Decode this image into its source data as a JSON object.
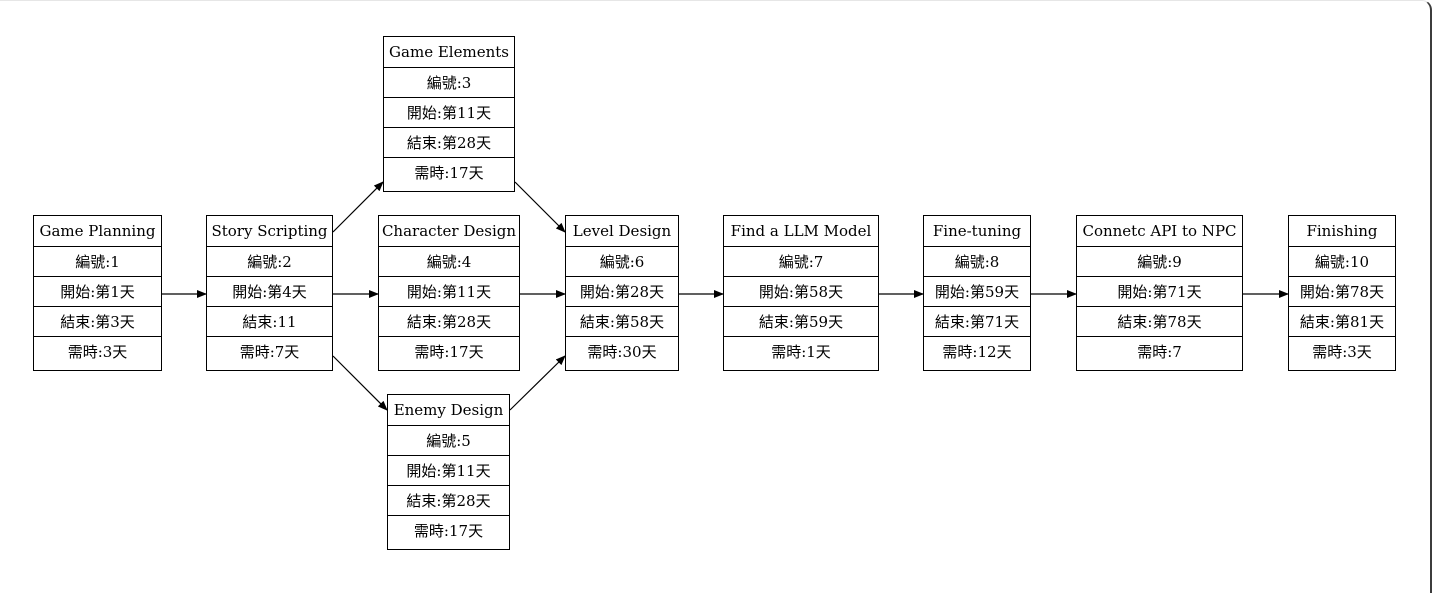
{
  "diagram": {
    "nodes": [
      {
        "id": "n1",
        "title": "Game Planning",
        "fields": [
          "編號:1",
          "開始:第1天",
          "結束:第3天",
          "需時:3天"
        ]
      },
      {
        "id": "n2",
        "title": "Story Scripting",
        "fields": [
          "編號:2",
          "開始:第4天",
          "結束:11",
          "需時:7天"
        ]
      },
      {
        "id": "n3",
        "title": "Game Elements",
        "fields": [
          "編號:3",
          "開始:第11天",
          "結束:第28天",
          "需時:17天"
        ]
      },
      {
        "id": "n4",
        "title": "Character Design",
        "fields": [
          "編號:4",
          "開始:第11天",
          "結束:第28天",
          "需時:17天"
        ]
      },
      {
        "id": "n5",
        "title": "Enemy Design",
        "fields": [
          "編號:5",
          "開始:第11天",
          "結束:第28天",
          "需時:17天"
        ]
      },
      {
        "id": "n6",
        "title": "Level Design",
        "fields": [
          "編號:6",
          "開始:第28天",
          "結束:第58天",
          "需時:30天"
        ]
      },
      {
        "id": "n7",
        "title": "Find a LLM Model",
        "fields": [
          "編號:7",
          "開始:第58天",
          "結束:第59天",
          "需時:1天"
        ]
      },
      {
        "id": "n8",
        "title": "Fine-tuning",
        "fields": [
          "編號:8",
          "開始:第59天",
          "結束:第71天",
          "需時:12天"
        ]
      },
      {
        "id": "n9",
        "title": "Connetc API to NPC",
        "fields": [
          "編號:9",
          "開始:第71天",
          "結束:第78天",
          "需時:7"
        ]
      },
      {
        "id": "n10",
        "title": "Finishing",
        "fields": [
          "編號:10",
          "開始:第78天",
          "結束:第81天",
          "需時:3天"
        ]
      }
    ],
    "edges": [
      [
        "n1",
        "n2"
      ],
      [
        "n2",
        "n3"
      ],
      [
        "n2",
        "n4"
      ],
      [
        "n2",
        "n5"
      ],
      [
        "n3",
        "n6"
      ],
      [
        "n4",
        "n6"
      ],
      [
        "n5",
        "n6"
      ],
      [
        "n6",
        "n7"
      ],
      [
        "n7",
        "n8"
      ],
      [
        "n8",
        "n9"
      ],
      [
        "n9",
        "n10"
      ]
    ]
  }
}
